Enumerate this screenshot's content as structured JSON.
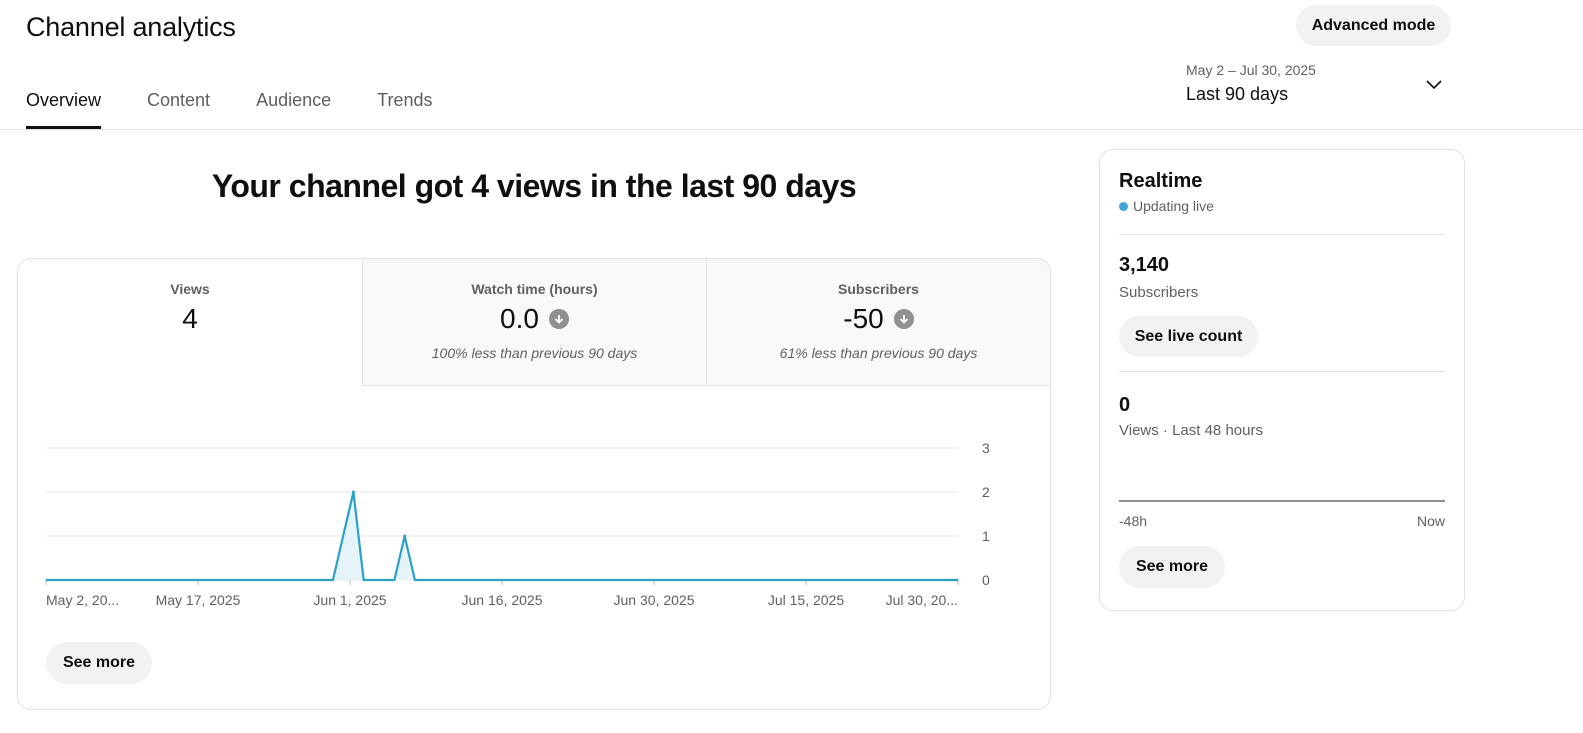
{
  "header": {
    "title": "Channel analytics",
    "advanced_mode_label": "Advanced mode"
  },
  "tabs": [
    {
      "label": "Overview",
      "active": true
    },
    {
      "label": "Content",
      "active": false
    },
    {
      "label": "Audience",
      "active": false
    },
    {
      "label": "Trends",
      "active": false
    }
  ],
  "date_picker": {
    "range": "May 2 – Jul 30, 2025",
    "label": "Last 90 days",
    "icon": "chevron-down-icon"
  },
  "headline": "Your channel got 4 views in the last 90 days",
  "metrics": [
    {
      "title": "Views",
      "value": "4",
      "note": "",
      "icon": ""
    },
    {
      "title": "Watch time (hours)",
      "value": "0.0",
      "note": "100% less than previous 90 days",
      "icon": "arrow-down-icon"
    },
    {
      "title": "Subscribers",
      "value": "-50",
      "note": "61% less than previous 90 days",
      "icon": "arrow-down-icon"
    }
  ],
  "chart_data": {
    "type": "area",
    "x_ticks": [
      "May 2, 20...",
      "May 17, 2025",
      "Jun 1, 2025",
      "Jun 16, 2025",
      "Jun 30, 2025",
      "Jul 15, 2025",
      "Jul 30, 20..."
    ],
    "ylim": [
      0,
      3
    ],
    "y_ticks": [
      0,
      1,
      2,
      3
    ],
    "x_days": [
      0,
      28,
      30,
      31,
      34,
      35,
      36,
      89
    ],
    "values": [
      0,
      0,
      2,
      0,
      0,
      1,
      0,
      0
    ],
    "color": "#2ba0c8",
    "grid": true
  },
  "see_more_label": "See more",
  "realtime": {
    "title": "Realtime",
    "status": "Updating live",
    "subscribers_value": "3,140",
    "subscribers_label": "Subscribers",
    "live_count_label": "See live count",
    "views_value": "0",
    "views_label": "Views · Last 48 hours",
    "axis_start": "-48h",
    "axis_end": "Now",
    "see_more_label": "See more"
  }
}
